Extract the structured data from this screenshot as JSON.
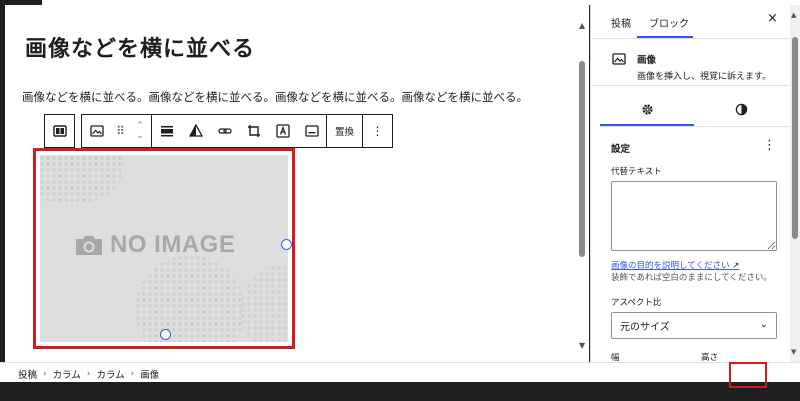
{
  "editor": {
    "title": "画像などを横に並べる",
    "paragraph": "画像などを横に並べる。画像などを横に並べる。画像などを横に並べる。画像などを横に並べる。"
  },
  "toolbar": {
    "replace_label": "置換",
    "mover_up": "⌃",
    "mover_down": "⌄",
    "more": "⋮"
  },
  "image": {
    "placeholder_text": "NO IMAGE"
  },
  "sidebar": {
    "tab_post": "投稿",
    "tab_block": "ブロック",
    "close": "×",
    "block_name": "画像",
    "block_description": "画像を挿入し、視覚に訴えます。",
    "settings_label": "設定",
    "alt_label": "代替テキスト",
    "alt_value": "",
    "alt_link": "画像の目的を説明してください",
    "alt_link_arrow": "↗",
    "alt_help": "装飾であれば空白のままにしてください。",
    "aspect_label": "アスペクト比",
    "aspect_value": "元のサイズ",
    "width_label": "幅",
    "height_label": "高さ"
  },
  "breadcrumb": {
    "items": [
      "投稿",
      "カラム",
      "カラム",
      "画像"
    ],
    "separator": "›"
  },
  "colors": {
    "accent": "#3858e9",
    "highlight": "#d01c1f",
    "text": "#1e1e1e"
  }
}
